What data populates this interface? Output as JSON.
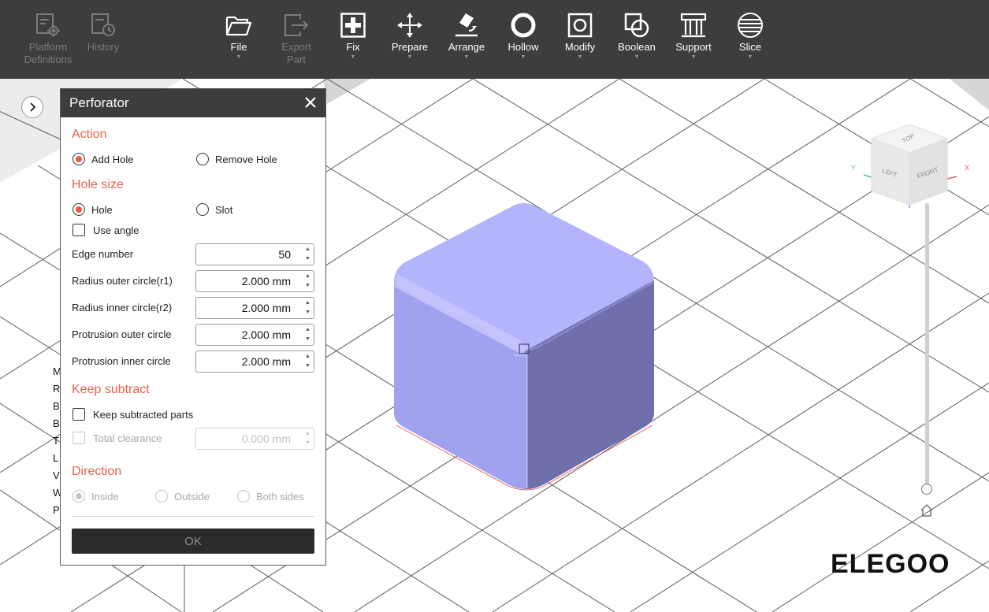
{
  "app": {
    "brand": "ELEGOO"
  },
  "toolbar": {
    "left": [
      {
        "key": "platform",
        "label": "Platform\nDefinitions",
        "icon": "platform-settings-icon",
        "disabled": true
      },
      {
        "key": "history",
        "label": "History",
        "icon": "history-icon",
        "disabled": true
      }
    ],
    "main": [
      {
        "key": "file",
        "label": "File",
        "icon": "folder-icon",
        "has_menu": true
      },
      {
        "key": "export",
        "label": "Export\nPart",
        "icon": "export-icon",
        "disabled": true
      },
      {
        "key": "fix",
        "label": "Fix",
        "icon": "fix-plus-icon",
        "has_menu": true
      },
      {
        "key": "prepare",
        "label": "Prepare",
        "icon": "move-arrows-icon",
        "has_menu": true
      },
      {
        "key": "arrange",
        "label": "Arrange",
        "icon": "arrange-icon",
        "has_menu": true
      },
      {
        "key": "hollow",
        "label": "Hollow",
        "icon": "hollow-ring-icon",
        "has_menu": true
      },
      {
        "key": "modify",
        "label": "Modify",
        "icon": "modify-icon",
        "has_menu": true
      },
      {
        "key": "boolean",
        "label": "Boolean",
        "icon": "boolean-icon",
        "has_menu": true
      },
      {
        "key": "support",
        "label": "Support",
        "icon": "support-icon",
        "has_menu": true
      },
      {
        "key": "slice",
        "label": "Slice",
        "icon": "slice-icon",
        "has_menu": true
      }
    ]
  },
  "side_panel": {
    "letters": [
      "M",
      "R",
      "B",
      "B",
      "T",
      "L",
      "V",
      "W",
      "P"
    ]
  },
  "perforator": {
    "title": "Perforator",
    "action": {
      "title": "Action",
      "options": [
        {
          "label": "Add Hole",
          "selected": true
        },
        {
          "label": "Remove Hole",
          "selected": false
        }
      ]
    },
    "hole_size": {
      "title": "Hole size",
      "options": [
        {
          "label": "Hole",
          "selected": true
        },
        {
          "label": "Slot",
          "selected": false
        }
      ],
      "use_angle": {
        "label": "Use angle",
        "checked": false
      },
      "fields": [
        {
          "label": "Edge number",
          "value": "50"
        },
        {
          "label": "Radius outer circle(r1)",
          "value": "2.000 mm"
        },
        {
          "label": "Radius inner circle(r2)",
          "value": "2.000 mm"
        },
        {
          "label": "Protrusion outer circle",
          "value": "2.000 mm"
        },
        {
          "label": "Protrusion inner circle",
          "value": "2.000 mm"
        }
      ]
    },
    "keep_subtract": {
      "title": "Keep subtract",
      "keep_parts": {
        "label": "Keep subtracted parts",
        "checked": false
      },
      "total_clearance": {
        "label": "Total clearance",
        "value": "0.000 mm",
        "enabled": false
      }
    },
    "direction": {
      "title": "Direction",
      "options": [
        {
          "label": "Inside",
          "selected": true
        },
        {
          "label": "Outside",
          "selected": false
        },
        {
          "label": "Both sides",
          "selected": false
        }
      ],
      "enabled": false
    },
    "ok_label": "OK"
  },
  "nav_cube": {
    "faces": [
      "TOP",
      "LEFT",
      "FRONT"
    ],
    "axes": [
      "Y",
      "X"
    ]
  },
  "colors": {
    "toolbar_bg": "#3d3d3d",
    "accent": "#e8604c",
    "model": "#a3a4f2",
    "grid_line": "#5c5c5c",
    "disabled_text": "#7c7c7c"
  }
}
